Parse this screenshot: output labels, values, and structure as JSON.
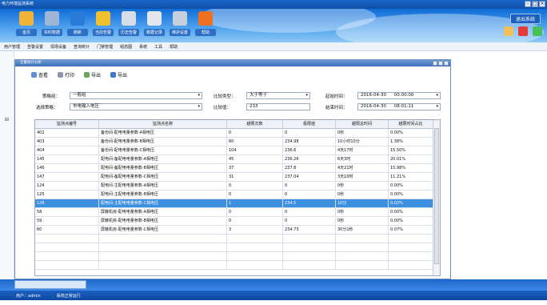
{
  "window": {
    "title": "电力环境监测系统",
    "controls": [
      "-",
      "□",
      "×"
    ]
  },
  "toolbar": {
    "items": [
      {
        "label": "首页",
        "color": "#f0b43a"
      },
      {
        "label": "实时数据",
        "color": "#9fb6d7"
      },
      {
        "label": "刷新",
        "color": "#2a7ad7"
      },
      {
        "label": "当前告警",
        "color": "#f0c02e"
      },
      {
        "label": "历史告警",
        "color": "#d7dde6"
      },
      {
        "label": "数据记录",
        "color": "#e3e6ea"
      },
      {
        "label": "维护设置",
        "color": "#c6d0dc"
      },
      {
        "label": "帮助",
        "color": "#f07020"
      }
    ],
    "exit_label": "退出系统"
  },
  "menu": {
    "items": [
      "用户管理",
      "告警设置",
      "现场设备",
      "查询统计",
      "门禁管理",
      "组态图",
      "系统",
      "工具",
      "帮助"
    ]
  },
  "child_window": {
    "title": "告警统计分析"
  },
  "actions": [
    {
      "label": "查看",
      "icon": "search-icon"
    },
    {
      "label": "打印",
      "icon": "printer-icon"
    },
    {
      "label": "导出",
      "icon": "export-icon"
    },
    {
      "label": "导出",
      "icon": "excel-icon"
    }
  ],
  "filters": {
    "strategy_group_label": "策略组：",
    "strategy_group_value": "一般组",
    "select_strategy_label": "选择策略：",
    "select_strategy_value": "市电输入电压",
    "compare_type_label": "比较类型：",
    "compare_type_value": "大于等于",
    "compare_value_label": "比较值：",
    "compare_value": "233",
    "start_time_label": "起始时间：",
    "start_date": "2016-04-30",
    "start_time": "00:00:00",
    "end_time_label": "结束时间：",
    "end_date": "2016-04-30",
    "end_time": "08:01:11"
  },
  "table": {
    "columns": [
      "监测点编号",
      "监测点名称",
      "越限次数",
      "极限值",
      "越限总时间",
      "越限时间占比"
    ],
    "rows": [
      [
        "402",
        "备份间-配电电量参数-A相电压",
        "0",
        "0",
        "0秒",
        "0.00%"
      ],
      [
        "403",
        "备份间-配电电量参数-B相电压",
        "60",
        "234.98",
        "10小时10分",
        "1.38%"
      ],
      [
        "404",
        "备份间-配电电量参数-C相电压",
        "104",
        "236.6",
        "4天17时",
        "15.50%"
      ],
      [
        "145",
        "配电间-备配电电量参数-A相电压",
        "45",
        "236.26",
        "6天3时",
        "20.01%"
      ],
      [
        "146",
        "配电间-备配电电量参数-B相电压",
        "37",
        "237.8",
        "4天21时",
        "15.98%"
      ],
      [
        "147",
        "配电间-备配电电量参数-C相电压",
        "31",
        "237.04",
        "3天10时",
        "11.21%"
      ],
      [
        "124",
        "配电间-主配电电量参数-A相电压",
        "0",
        "0",
        "0秒",
        "0.00%"
      ],
      [
        "125",
        "配电间-主配电电量参数-B相电压",
        "0",
        "0",
        "0秒",
        "0.00%"
      ],
      [
        "126",
        "配电间-主配电电量参数-C相电压",
        "1",
        "234.5",
        "10分",
        "0.02%"
      ],
      [
        "58",
        "屏蔽机房-配电电量参数-A相电压",
        "0",
        "0",
        "0秒",
        "0.00%"
      ],
      [
        "59",
        "屏蔽机房-配电电量参数-B相电压",
        "0",
        "0",
        "0秒",
        "0.00%"
      ],
      [
        "60",
        "屏蔽机房-配电电量参数-C相电压",
        "3",
        "234.73",
        "30分1秒",
        "0.07%"
      ]
    ],
    "selected_index": 8
  },
  "status": {
    "user": "用户：admin",
    "state": "系统正常运行"
  }
}
